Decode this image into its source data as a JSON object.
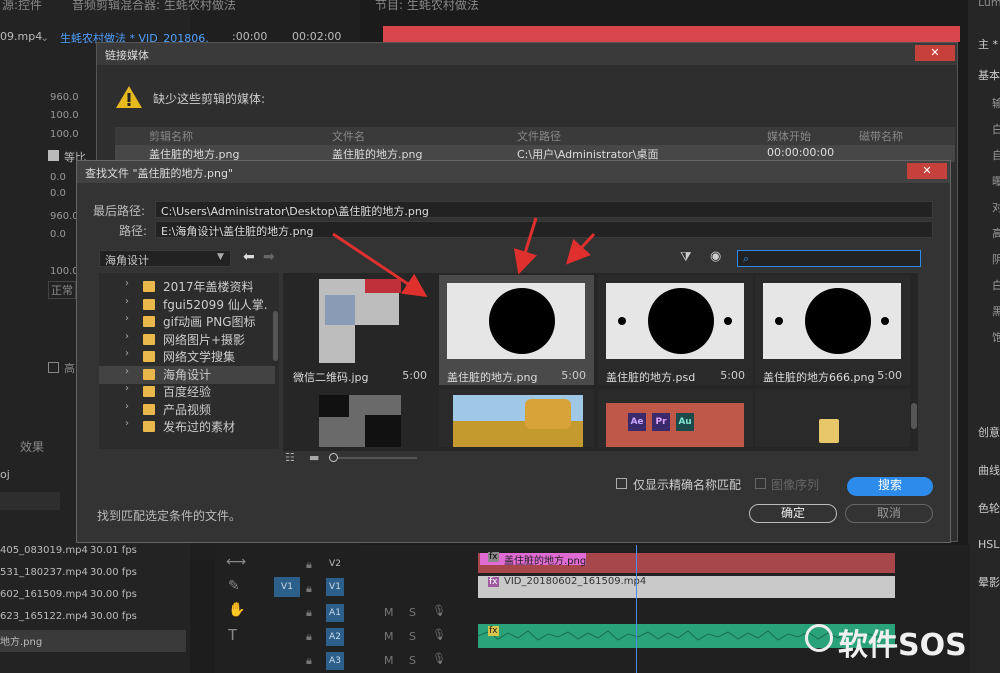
{
  "bg": {
    "left_tab": "源:控件",
    "left_clip": "09.mp4",
    "mid_header": "音频剪辑混合器: 生蚝农村做法",
    "mid_clip": "生蚝农村做法 * VID_201806...",
    "mid_time1": ":00:00",
    "mid_time2": "00:02:00",
    "prog_header": "节目: 生蚝农村做法",
    "right_tab": "Lum",
    "left_values": [
      "960.0",
      "100.0",
      "100.0",
      "0.0",
      "0.0",
      "960.0",
      "0.0",
      "100.0"
    ],
    "left_label_eq": "等比",
    "left_label_zheng": "正常",
    "left_label_gao": "高",
    "effects_tab": "效果",
    "left_oj": "oj",
    "file_rows": [
      {
        "name": "405_083019.mp4",
        "fps": "30.01 fps"
      },
      {
        "name": "531_180237.mp4",
        "fps": "30.00 fps"
      },
      {
        "name": "602_161509.mp4",
        "fps": "30.00 fps"
      },
      {
        "name": "623_165122.mp4",
        "fps": "30.00 fps"
      },
      {
        "name": "地方.png",
        "fps": ""
      }
    ],
    "right_items": [
      "主 *",
      "基本",
      "创意",
      "曲线",
      "色轮",
      "HSL",
      "晕影"
    ],
    "right_side_chars": [
      "输",
      "白",
      "自",
      "曝",
      "对",
      "高",
      "阴",
      "白",
      "黑",
      "饱"
    ]
  },
  "timeline": {
    "v2": "V2",
    "v1": "V1",
    "v1_src": "V1",
    "a1": "A1",
    "a2": "A2",
    "a3": "A3",
    "clip_png": "盖住脏的地方.png",
    "clip_vid": "VID_20180602_161509.mp4",
    "fx": "fx",
    "m": "M",
    "s": "S"
  },
  "link_dialog": {
    "title": "链接媒体",
    "message": "缺少这些剪辑的媒体:",
    "columns": [
      "剪辑名称",
      "文件名",
      "文件路径",
      "媒体开始",
      "磁带名称"
    ],
    "row": [
      "盖住脏的地方.png",
      "盖住脏的地方.png",
      "C:\\用户\\Administrator\\桌面",
      "00:00:00:00",
      ""
    ]
  },
  "find_dialog": {
    "title": "查找文件 \"盖住脏的地方.png\"",
    "last_path_label": "最后路径:",
    "last_path": "C:\\Users\\Administrator\\Desktop\\盖住脏的地方.png",
    "path_label": "路径:",
    "path": "E:\\海角设计\\盖住脏的地方.png",
    "location": "海角设计",
    "folders": [
      "2017年盖楼资料",
      "fgui52099 仙人掌.",
      "gif动画 PNG图标",
      "网络图片+摄影",
      "网络文学搜集",
      "海角设计",
      "百度经验",
      "产品视频",
      "发布过的素材"
    ],
    "selected_folder_index": 5,
    "thumbnails": [
      {
        "name": "微信二维码.jpg",
        "duration": "5:00"
      },
      {
        "name": "盖住脏的地方.png",
        "duration": "5:00"
      },
      {
        "name": "盖住脏的地方.psd",
        "duration": "5:00"
      },
      {
        "name": "盖住脏的地方666.png",
        "duration": "5:00"
      }
    ],
    "app_icons": [
      "Ae",
      "Pr",
      "Au"
    ],
    "exact_match_label": "仅显示精确名称匹配",
    "image_sequence_label": "图像序列",
    "search_button": "搜索",
    "status": "找到匹配选定条件的文件。",
    "ok_button": "确定",
    "cancel_button": "取消"
  },
  "watermark": "软件SOS",
  "colors": {
    "accent_blue": "#2d8ceb",
    "close_red": "#c7413c",
    "clip_pink": "#e06bd3",
    "clip_red": "#a7474c",
    "audio_green": "#2aa37a",
    "arrow_red": "#e0302e",
    "folder_yellow": "#e8b84a"
  }
}
